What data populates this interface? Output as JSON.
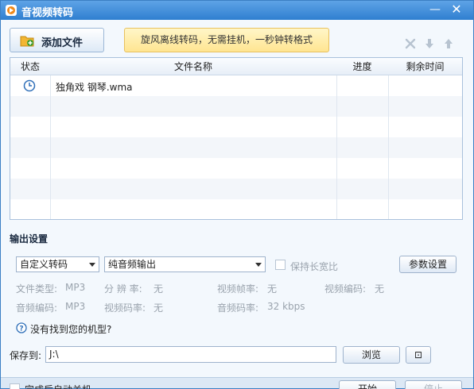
{
  "window": {
    "title": "音视频转码",
    "minimize": "—",
    "close": "✕"
  },
  "toolbar": {
    "add_file_label": "添加文件",
    "banner_text": "旋风离线转码，无需挂机，一秒钟转格式",
    "icons": [
      "delete-icon",
      "move-down-icon",
      "move-up-icon"
    ]
  },
  "table": {
    "columns": [
      "状态",
      "文件名称",
      "进度",
      "剩余时间"
    ],
    "rows": [
      {
        "status_icon": "clock-icon",
        "name": "独角戏 钢琴.wma",
        "progress": "",
        "remaining": ""
      }
    ]
  },
  "output": {
    "section_title": "输出设置",
    "mode_value": "自定义转码",
    "output_value": "纯音频输出",
    "keep_ratio_label": "保持长宽比",
    "params_button": "参数设置",
    "file_type_label": "文件类型:",
    "file_type_value": "MP3",
    "resolution_label": "分 辨 率:",
    "resolution_value": "无",
    "video_framerate_label": "视频帧率:",
    "video_framerate_value": "无",
    "video_codec_label": "视频编码:",
    "video_codec_value": "无",
    "audio_codec_label": "音频编码:",
    "audio_codec_value": "MP3",
    "video_bitrate_label": "视频码率:",
    "video_bitrate_value": "无",
    "audio_bitrate_label": "音频码率:",
    "audio_bitrate_value": "32 kbps",
    "help_text": "没有找到您的机型?"
  },
  "save": {
    "label": "保存到:",
    "path": "J:\\",
    "browse_button": "浏览",
    "open_button": "⊡"
  },
  "footer": {
    "shutdown_label": "完成后自动关机",
    "start_button": "开始",
    "stop_button": "停止"
  },
  "colors": {
    "titlebar": "#2f7fd0",
    "banner": "#ffe591",
    "window_bg": "#f3f8fd"
  }
}
